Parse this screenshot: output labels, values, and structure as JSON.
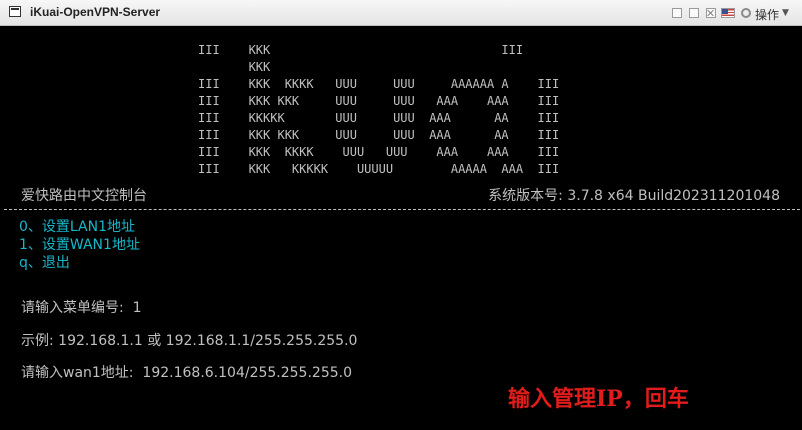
{
  "window": {
    "title": "iKuai-OpenVPN-Server",
    "ops_label": "操作"
  },
  "console": {
    "banner_lines": [
      "III    KKK                                III",
      "       KKK",
      "III    KKK  KKKK   UUU     UUU     AAAAAA A    III",
      "III    KKK KKK     UUU     UUU   AAA    AAA    III",
      "III    KKKKK       UUU     UUU  AAA      AA    III",
      "III    KKK KKK     UUU     UUU  AAA      AA    III",
      "III    KKK  KKKK    UUU   UUU    AAA    AAA    III",
      "III    KKK   KKKKK    UUUUU        AAAAA  AAA  III"
    ],
    "console_name": "爱快路由中文控制台",
    "system_version": "系统版本号: 3.7.8 x64 Build202311201048",
    "menu_items": [
      "0、设置LAN1地址",
      "1、设置WAN1地址",
      "q、退出"
    ],
    "prompt_menu": "请输入菜单编号:  1",
    "example": "示例: 192.168.1.1 或 192.168.1.1/255.255.255.0",
    "prompt_wan": "请输入wan1地址:  192.168.6.104/255.255.255.0"
  },
  "annotation": "输入管理IP，回车",
  "colors": {
    "terminal_bg": "#000000",
    "terminal_text": "#c0c0c0",
    "menu_text": "#18b6c9",
    "annotation_red": "#e21b1b"
  }
}
